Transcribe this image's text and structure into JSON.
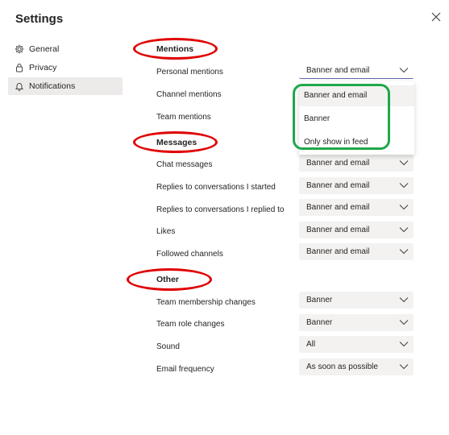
{
  "window": {
    "title": "Settings"
  },
  "nav": {
    "items": [
      {
        "label": "General",
        "icon": "gear-icon"
      },
      {
        "label": "Privacy",
        "icon": "lock-icon"
      },
      {
        "label": "Notifications",
        "icon": "bell-icon",
        "active": true
      }
    ]
  },
  "sections": {
    "mentions": {
      "heading": "Mentions",
      "rows": [
        {
          "label": "Personal mentions",
          "value": "Banner and email"
        },
        {
          "label": "Channel mentions",
          "value": "Banner and email"
        },
        {
          "label": "Team mentions",
          "value": "Banner and email"
        }
      ]
    },
    "messages": {
      "heading": "Messages",
      "rows": [
        {
          "label": "Chat messages",
          "value": "Banner and email"
        },
        {
          "label": "Replies to conversations I started",
          "value": "Banner and email"
        },
        {
          "label": "Replies to conversations I replied to",
          "value": "Banner and email"
        },
        {
          "label": "Likes",
          "value": "Banner and email"
        },
        {
          "label": "Followed channels",
          "value": "Banner and email"
        }
      ]
    },
    "other": {
      "heading": "Other",
      "rows": [
        {
          "label": "Team membership changes",
          "value": "Banner"
        },
        {
          "label": "Team role changes",
          "value": "Banner"
        },
        {
          "label": "Sound",
          "value": "All"
        },
        {
          "label": "Email frequency",
          "value": "As soon as possible"
        }
      ]
    }
  },
  "dropdown": {
    "options": [
      "Banner and email",
      "Banner",
      "Only show in feed"
    ]
  },
  "colors": {
    "accent": "#6264a7",
    "annotation_red": "#e00000",
    "annotation_green": "#1fa84a",
    "select_bg": "#f3f2f1"
  }
}
